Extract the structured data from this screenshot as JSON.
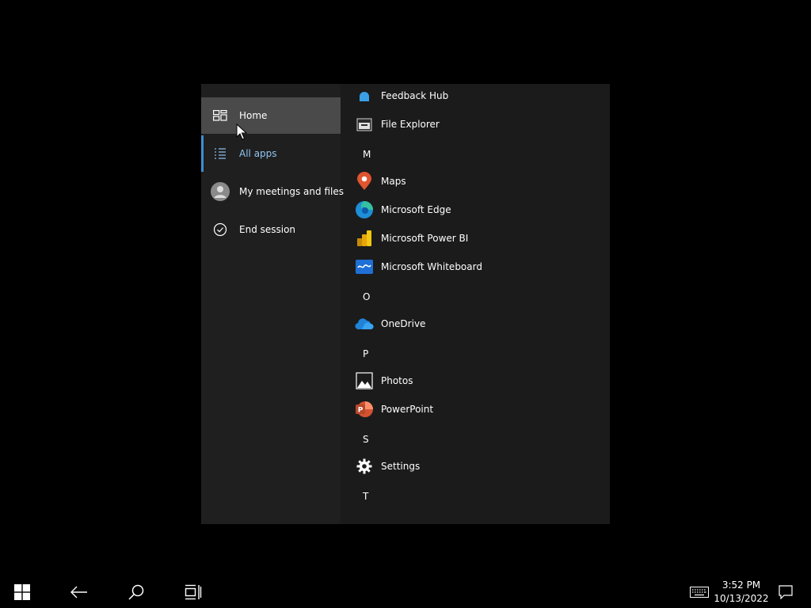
{
  "nav": {
    "items": [
      {
        "label": "Home",
        "icon": "home-icon"
      },
      {
        "label": "All apps",
        "icon": "all-apps-icon"
      },
      {
        "label": "My meetings and files",
        "icon": "person-icon"
      },
      {
        "label": "End session",
        "icon": "check-circle-icon"
      }
    ],
    "hovered": "Home",
    "selected": "All apps",
    "accent_color": "#3e8fd1"
  },
  "apps": {
    "items": [
      {
        "type": "app",
        "label": "Feedback Hub",
        "icon": "feedback-hub-icon"
      },
      {
        "type": "app",
        "label": "File Explorer",
        "icon": "file-explorer-icon"
      },
      {
        "type": "letter",
        "label": "M"
      },
      {
        "type": "app",
        "label": "Maps",
        "icon": "maps-icon"
      },
      {
        "type": "app",
        "label": "Microsoft Edge",
        "icon": "edge-icon"
      },
      {
        "type": "app",
        "label": "Microsoft Power BI",
        "icon": "power-bi-icon"
      },
      {
        "type": "app",
        "label": "Microsoft Whiteboard",
        "icon": "whiteboard-icon"
      },
      {
        "type": "letter",
        "label": "O"
      },
      {
        "type": "app",
        "label": "OneDrive",
        "icon": "onedrive-icon"
      },
      {
        "type": "letter",
        "label": "P"
      },
      {
        "type": "app",
        "label": "Photos",
        "icon": "photos-icon"
      },
      {
        "type": "app",
        "label": "PowerPoint",
        "icon": "powerpoint-icon"
      },
      {
        "type": "letter",
        "label": "S"
      },
      {
        "type": "app",
        "label": "Settings",
        "icon": "gear-icon"
      },
      {
        "type": "letter",
        "label": "T"
      }
    ]
  },
  "taskbar": {
    "buttons": [
      "windows-start-icon",
      "back-arrow-icon",
      "search-icon",
      "task-view-icon"
    ],
    "tray": [
      "keyboard-icon",
      "notification-icon"
    ],
    "time": "3:52 PM",
    "date": "10/13/2022"
  }
}
